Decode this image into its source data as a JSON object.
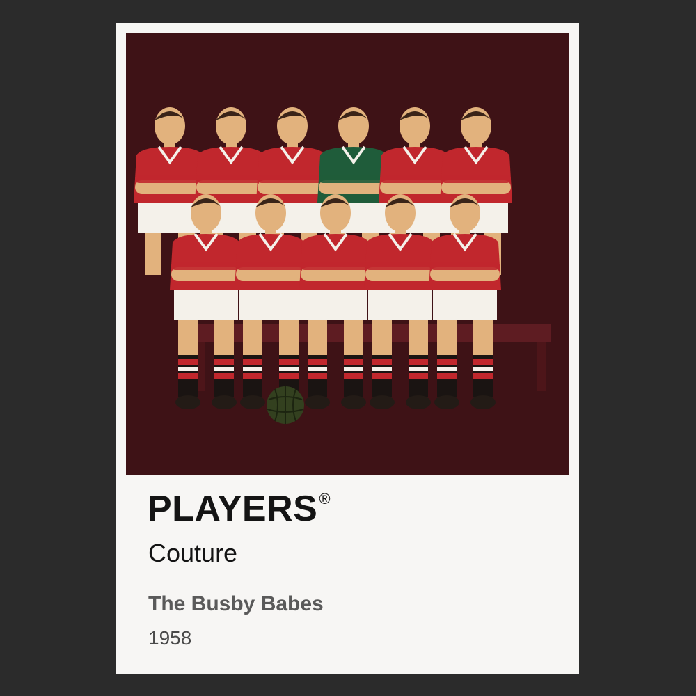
{
  "poster": {
    "brand": "PLAYERS",
    "registered_mark": "®",
    "subtitle": "Couture",
    "team_name": "The Busby Babes",
    "year": "1958"
  },
  "illustration": {
    "background_color": "#3e1216",
    "shirt_color": "#c1272d",
    "keeper_shirt_color": "#1f5c3a",
    "shorts_color": "#f4f1ea",
    "skin_color": "#e2b27d",
    "back_row_count": 6,
    "front_row_count": 5,
    "ball_icon": "football-icon"
  },
  "colors": {
    "page_background": "#2b2b2b",
    "poster_paper": "#f7f6f4",
    "brand_text": "#141414",
    "title_text": "#5a5a5a"
  }
}
